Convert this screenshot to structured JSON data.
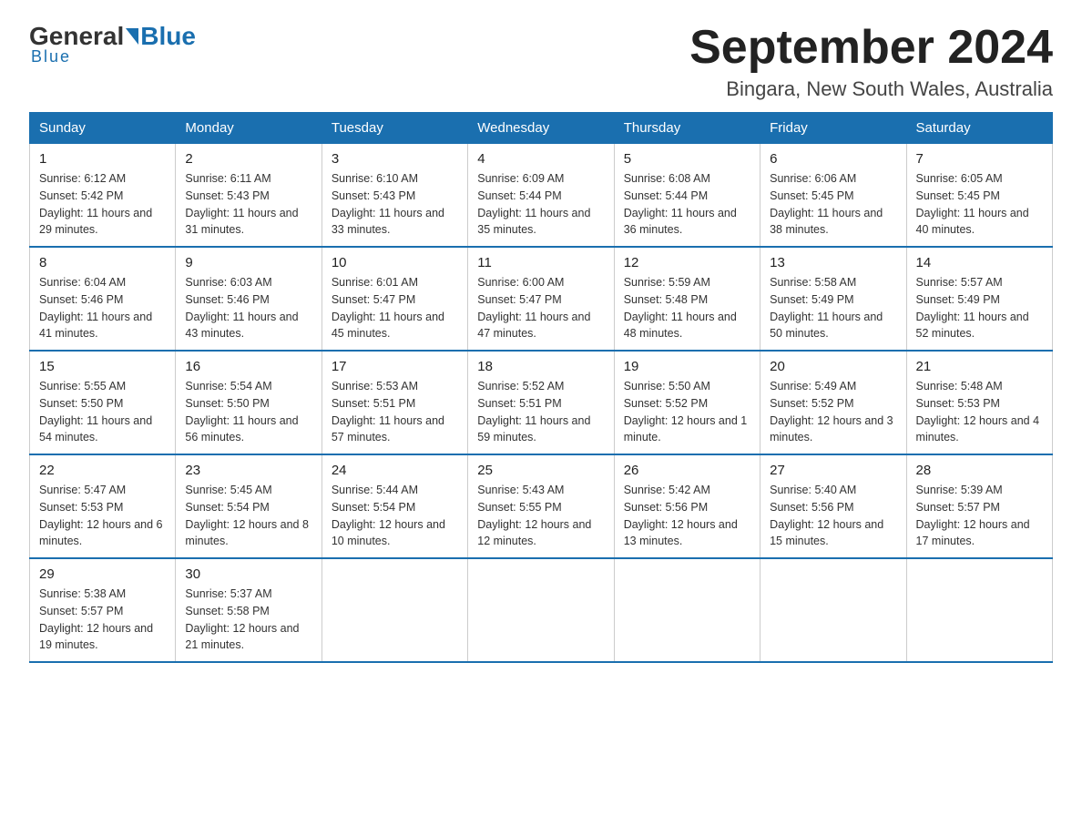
{
  "logo": {
    "general": "General",
    "blue": "Blue",
    "underline": "Blue"
  },
  "header": {
    "month": "September 2024",
    "location": "Bingara, New South Wales, Australia"
  },
  "weekdays": [
    "Sunday",
    "Monday",
    "Tuesday",
    "Wednesday",
    "Thursday",
    "Friday",
    "Saturday"
  ],
  "weeks": [
    [
      {
        "day": "1",
        "sunrise": "6:12 AM",
        "sunset": "5:42 PM",
        "daylight": "11 hours and 29 minutes."
      },
      {
        "day": "2",
        "sunrise": "6:11 AM",
        "sunset": "5:43 PM",
        "daylight": "11 hours and 31 minutes."
      },
      {
        "day": "3",
        "sunrise": "6:10 AM",
        "sunset": "5:43 PM",
        "daylight": "11 hours and 33 minutes."
      },
      {
        "day": "4",
        "sunrise": "6:09 AM",
        "sunset": "5:44 PM",
        "daylight": "11 hours and 35 minutes."
      },
      {
        "day": "5",
        "sunrise": "6:08 AM",
        "sunset": "5:44 PM",
        "daylight": "11 hours and 36 minutes."
      },
      {
        "day": "6",
        "sunrise": "6:06 AM",
        "sunset": "5:45 PM",
        "daylight": "11 hours and 38 minutes."
      },
      {
        "day": "7",
        "sunrise": "6:05 AM",
        "sunset": "5:45 PM",
        "daylight": "11 hours and 40 minutes."
      }
    ],
    [
      {
        "day": "8",
        "sunrise": "6:04 AM",
        "sunset": "5:46 PM",
        "daylight": "11 hours and 41 minutes."
      },
      {
        "day": "9",
        "sunrise": "6:03 AM",
        "sunset": "5:46 PM",
        "daylight": "11 hours and 43 minutes."
      },
      {
        "day": "10",
        "sunrise": "6:01 AM",
        "sunset": "5:47 PM",
        "daylight": "11 hours and 45 minutes."
      },
      {
        "day": "11",
        "sunrise": "6:00 AM",
        "sunset": "5:47 PM",
        "daylight": "11 hours and 47 minutes."
      },
      {
        "day": "12",
        "sunrise": "5:59 AM",
        "sunset": "5:48 PM",
        "daylight": "11 hours and 48 minutes."
      },
      {
        "day": "13",
        "sunrise": "5:58 AM",
        "sunset": "5:49 PM",
        "daylight": "11 hours and 50 minutes."
      },
      {
        "day": "14",
        "sunrise": "5:57 AM",
        "sunset": "5:49 PM",
        "daylight": "11 hours and 52 minutes."
      }
    ],
    [
      {
        "day": "15",
        "sunrise": "5:55 AM",
        "sunset": "5:50 PM",
        "daylight": "11 hours and 54 minutes."
      },
      {
        "day": "16",
        "sunrise": "5:54 AM",
        "sunset": "5:50 PM",
        "daylight": "11 hours and 56 minutes."
      },
      {
        "day": "17",
        "sunrise": "5:53 AM",
        "sunset": "5:51 PM",
        "daylight": "11 hours and 57 minutes."
      },
      {
        "day": "18",
        "sunrise": "5:52 AM",
        "sunset": "5:51 PM",
        "daylight": "11 hours and 59 minutes."
      },
      {
        "day": "19",
        "sunrise": "5:50 AM",
        "sunset": "5:52 PM",
        "daylight": "12 hours and 1 minute."
      },
      {
        "day": "20",
        "sunrise": "5:49 AM",
        "sunset": "5:52 PM",
        "daylight": "12 hours and 3 minutes."
      },
      {
        "day": "21",
        "sunrise": "5:48 AM",
        "sunset": "5:53 PM",
        "daylight": "12 hours and 4 minutes."
      }
    ],
    [
      {
        "day": "22",
        "sunrise": "5:47 AM",
        "sunset": "5:53 PM",
        "daylight": "12 hours and 6 minutes."
      },
      {
        "day": "23",
        "sunrise": "5:45 AM",
        "sunset": "5:54 PM",
        "daylight": "12 hours and 8 minutes."
      },
      {
        "day": "24",
        "sunrise": "5:44 AM",
        "sunset": "5:54 PM",
        "daylight": "12 hours and 10 minutes."
      },
      {
        "day": "25",
        "sunrise": "5:43 AM",
        "sunset": "5:55 PM",
        "daylight": "12 hours and 12 minutes."
      },
      {
        "day": "26",
        "sunrise": "5:42 AM",
        "sunset": "5:56 PM",
        "daylight": "12 hours and 13 minutes."
      },
      {
        "day": "27",
        "sunrise": "5:40 AM",
        "sunset": "5:56 PM",
        "daylight": "12 hours and 15 minutes."
      },
      {
        "day": "28",
        "sunrise": "5:39 AM",
        "sunset": "5:57 PM",
        "daylight": "12 hours and 17 minutes."
      }
    ],
    [
      {
        "day": "29",
        "sunrise": "5:38 AM",
        "sunset": "5:57 PM",
        "daylight": "12 hours and 19 minutes."
      },
      {
        "day": "30",
        "sunrise": "5:37 AM",
        "sunset": "5:58 PM",
        "daylight": "12 hours and 21 minutes."
      },
      null,
      null,
      null,
      null,
      null
    ]
  ]
}
